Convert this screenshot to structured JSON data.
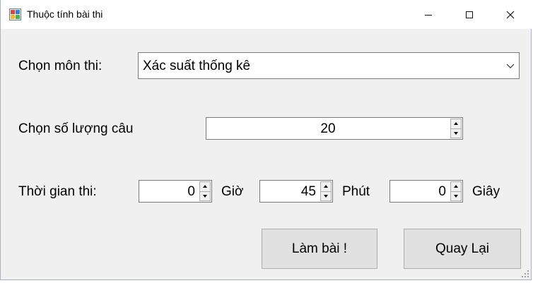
{
  "window": {
    "title": "Thuộc tính bài thi",
    "icon": "app-window-icon",
    "controls": [
      "minimize-icon",
      "maximize-icon",
      "close-icon"
    ]
  },
  "subject": {
    "label": "Chọn môn thi:",
    "selected": "Xác suất thống kê"
  },
  "question_count": {
    "label": "Chọn số lượng câu",
    "value": "20"
  },
  "time": {
    "label": "Thời gian thi:",
    "hours": {
      "value": "0",
      "unit": "Giờ"
    },
    "minutes": {
      "value": "45",
      "unit": "Phút"
    },
    "seconds": {
      "value": "0",
      "unit": "Giây"
    }
  },
  "buttons": {
    "start": "Làm bài !",
    "back": "Quay Lại"
  }
}
